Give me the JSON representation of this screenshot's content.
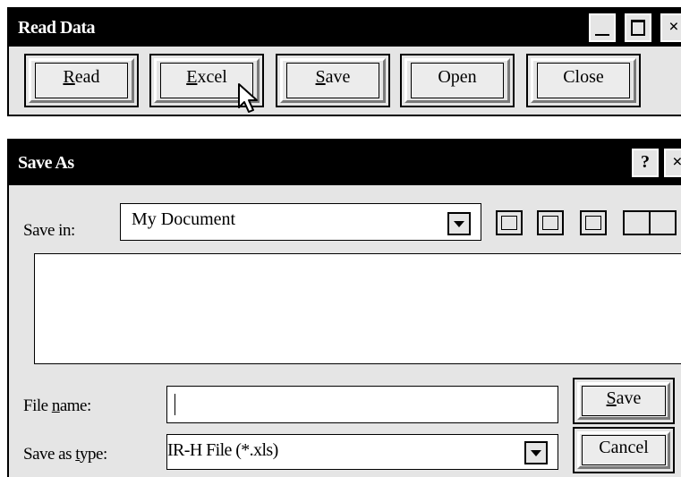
{
  "read_window": {
    "title": "Read Data",
    "buttons": {
      "read": {
        "prefix": "",
        "accel": "R",
        "rest": "ead"
      },
      "excel": {
        "prefix": "",
        "accel": "E",
        "rest": "xcel"
      },
      "save": {
        "prefix": "",
        "accel": "S",
        "rest": "ave"
      },
      "open": {
        "prefix": "",
        "accel": "",
        "rest": "Open"
      },
      "close": {
        "prefix": "",
        "accel": "",
        "rest": "Close"
      }
    },
    "titlebar_icons": [
      "minimize-icon",
      "maximize-icon",
      "close-icon"
    ],
    "close_glyph": "×"
  },
  "save_dialog": {
    "title": "Save As",
    "help_glyph": "?",
    "close_glyph": "×",
    "save_in": {
      "label": "Save in:",
      "value": "My Document"
    },
    "file_name": {
      "label_prefix": "File ",
      "label_accel": "n",
      "label_rest": "ame:",
      "value": ""
    },
    "save_as_type": {
      "label_prefix": "Save as ",
      "label_accel": "t",
      "label_rest": "ype:",
      "value": "IR-H File (*.xls)"
    },
    "buttons": {
      "save": {
        "accel": "S",
        "rest": "ave"
      },
      "cancel": {
        "accel": "",
        "rest": "Cancel"
      }
    },
    "toolbar_icons": [
      "up-folder-icon",
      "desktop-icon",
      "new-folder-icon",
      "view-toggle-icon"
    ]
  }
}
